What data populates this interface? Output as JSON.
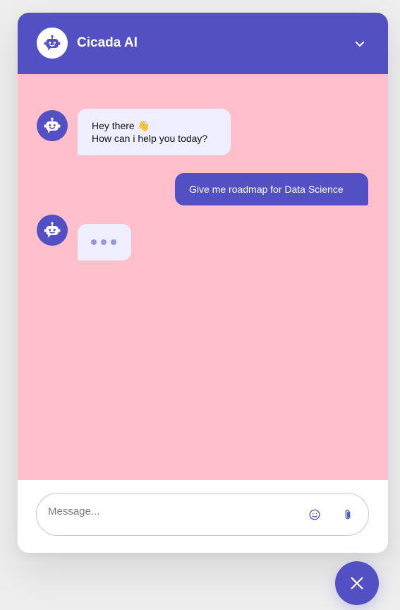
{
  "header": {
    "title": "Cicada AI",
    "avatar_icon": "robot-icon",
    "collapse_icon": "chevron-down-icon"
  },
  "messages": [
    {
      "role": "bot",
      "lines": [
        "Hey there 👋",
        "How can i help you today?"
      ]
    },
    {
      "role": "user",
      "text": "Give me roadmap for Data Science"
    },
    {
      "role": "bot",
      "typing": true
    }
  ],
  "composer": {
    "placeholder": "Message...",
    "value": "",
    "emoji_icon": "smiley-icon",
    "attach_icon": "paperclip-icon"
  },
  "toggle": {
    "icon": "close-icon"
  },
  "colors": {
    "accent": "#5350c4",
    "chat_background": "#ffc0cb",
    "bot_bubble": "#eeeefe",
    "page_background": "#eeeeef"
  }
}
